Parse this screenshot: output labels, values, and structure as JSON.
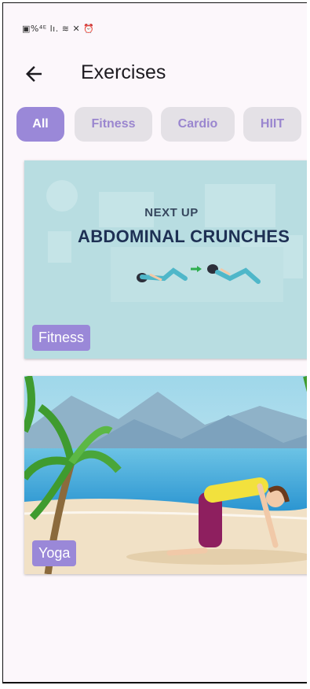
{
  "status_bar": {
    "text": "▣%⁴ᴱ lı. ≋ ✕ ⏰"
  },
  "app_bar": {
    "title": "Exercises",
    "back_icon": "arrow-back-icon"
  },
  "filters": [
    {
      "label": "All",
      "active": true
    },
    {
      "label": "Fitness",
      "active": false
    },
    {
      "label": "Cardio",
      "active": false
    },
    {
      "label": "HIIT",
      "active": false
    }
  ],
  "cards": [
    {
      "category": "Fitness",
      "banner_kicker": "NEXT UP",
      "banner_title": "ABDOMINAL CRUNCHES"
    },
    {
      "category": "Yoga"
    }
  ],
  "colors": {
    "accent": "#9a88d8",
    "chip_bg": "#e4e1e6",
    "background": "#fcf7fb"
  }
}
